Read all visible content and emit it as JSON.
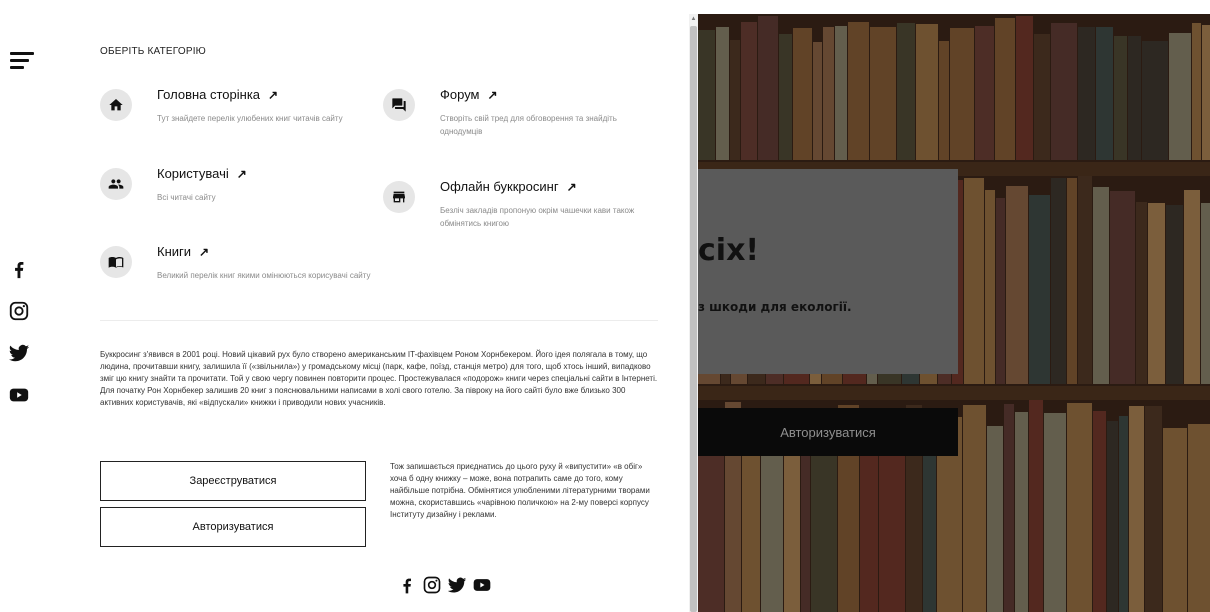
{
  "menu": {
    "category_title": "ОБЕРІТЬ КАТЕГОРІЮ",
    "arrow": "↗",
    "items": [
      {
        "label": "Головна сторінка",
        "desc": "Тут знайдете перелік улюбених книг читачів сайту",
        "icon": "home-icon"
      },
      {
        "label": "Форум",
        "desc": "Створіть свій тред для обговорення та знайдіть однодумців",
        "icon": "forum-icon"
      },
      {
        "label": "Користувачі",
        "desc": "Всі читачі сайту",
        "icon": "users-icon"
      },
      {
        "label": "Офлайн буккросинг",
        "desc": "Безліч закладів пропоную окрім чашечки кави також обмінятись книгою",
        "icon": "store-icon"
      },
      {
        "label": "Книги",
        "desc": "Великий перелік книг якими омінюються корисувачі сайту",
        "icon": "book-icon"
      }
    ]
  },
  "about": {
    "text": "Буккросинг з'явився в 2001 році. Новий цікавий рух було створено американським IT-фахівцем Роном Хорнбекером. Його ідея полягала в тому, що людина, прочитавши книгу, залишила її («звільнила») у громадському місці (парк, кафе, поїзд, станція метро) для того, щоб хтось інший, випадково зміг цю книгу знайти та прочитати. Той у свою чергу повинен повторити процес. Простежувалася «подорож» книги через спеціальні сайти в Інтернеті. Для початку Рон Хорнбекер залишив 20 книг з пояснювальними написами в холі свого готелю. За півроку на його сайті було вже близько 300 активних користувачів, які «відпускали» книжки і приводили нових учасників."
  },
  "actions": {
    "register_label": "Зареєструватися",
    "login_label": "Авторизуватися"
  },
  "side_note": {
    "text": "Тож запишається приєднатись до цього руху й «випустити» «в обіг» хоча б одну книжку – може, вона потрапить саме до того, кому найбільше потрібна. Обмінятися улюбленими літературними творами можна, скориставшись «чарівною поличкою» на 2-му поверсі корпусу Інституту дизайну і реклами."
  },
  "social": [
    "facebook-icon",
    "instagram-icon",
    "twitter-icon",
    "youtube-icon"
  ],
  "hero": {
    "title_fragment": "сіх!",
    "subtitle_fragment": "з шкоди для екології.",
    "button_label": "Авторизуватися"
  },
  "scrollbar": {
    "up_glyph": "▲"
  },
  "colors": {
    "panel_bg": "#ffffff",
    "icon_circle": "#e6e6e6",
    "muted_text": "#8a8a8a",
    "overlay_card": "#5a5a5a",
    "hero_button": "#0a0a0a"
  }
}
